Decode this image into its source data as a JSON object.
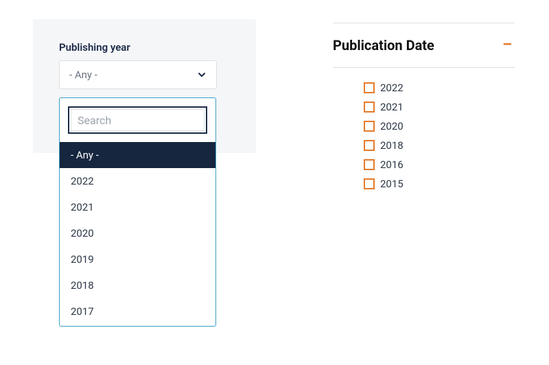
{
  "left": {
    "title": "Publishing year",
    "selected_label": "- Any -",
    "search_placeholder": "Search",
    "options": [
      "- Any -",
      "2022",
      "2021",
      "2020",
      "2019",
      "2018",
      "2017"
    ],
    "selected_index": 0
  },
  "right": {
    "title": "Publication Date",
    "items": [
      "2022",
      "2021",
      "2020",
      "2018",
      "2016",
      "2015"
    ]
  }
}
